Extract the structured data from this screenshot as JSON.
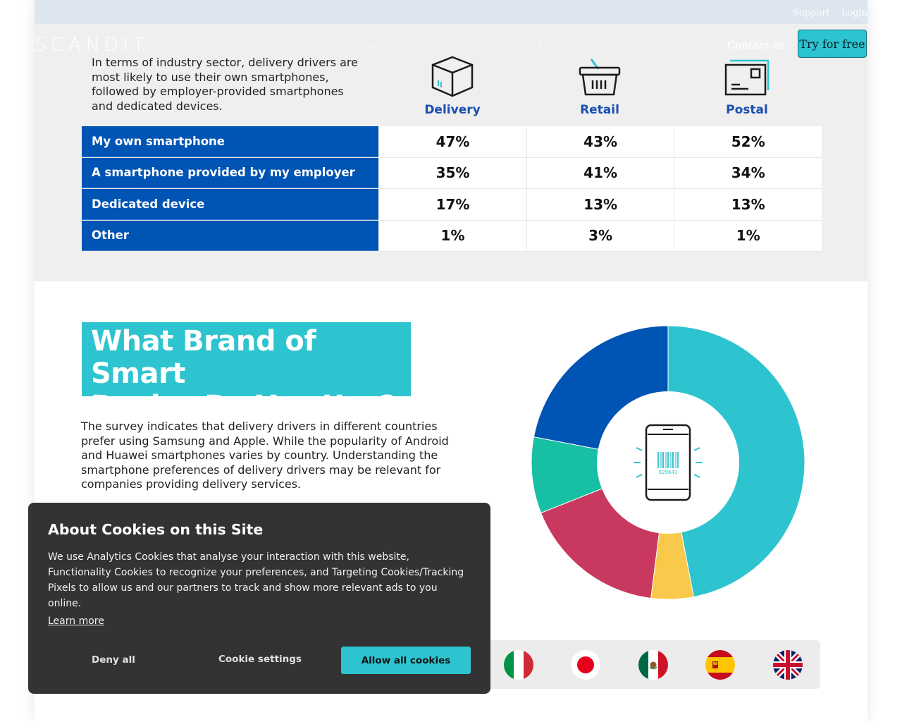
{
  "topbar": {
    "links": [
      "Support",
      "Login"
    ]
  },
  "nav": {
    "logo": "SCANDIT",
    "menu": [
      "Products",
      "Industries",
      "Developers",
      "Resources",
      "About"
    ],
    "contact_label": "Contact us",
    "try_label": "Try for free",
    "icons": [
      "search-icon",
      "globe-icon"
    ]
  },
  "device_section": {
    "intro": "In terms of industry sector, delivery drivers are most likely to use their own smartphones, followed by employer-provided smartphones and dedicated devices.",
    "sectors": [
      {
        "label": "Delivery",
        "icon": "box-icon"
      },
      {
        "label": "Retail",
        "icon": "basket-icon"
      },
      {
        "label": "Postal",
        "icon": "envelope-icon"
      }
    ],
    "rows": [
      {
        "label": "My own smartphone",
        "values": [
          "47%",
          "43%",
          "52%"
        ]
      },
      {
        "label": "A smartphone provided by my employer",
        "values": [
          "35%",
          "41%",
          "34%"
        ]
      },
      {
        "label": "Dedicated device",
        "values": [
          "17%",
          "13%",
          "13%"
        ]
      },
      {
        "label": "Other",
        "values": [
          "1%",
          "3%",
          "1%"
        ]
      }
    ]
  },
  "brand_section": {
    "headline_line1": "What Brand of Smart",
    "headline_line2": "Device Do You Use?",
    "headline_mark": "†",
    "body": "The survey indicates that delivery drivers in different countries prefer using Samsung and Apple. While the popularity of Android and Huawei smartphones varies by country. Understanding the smartphone preferences of delivery drivers may be relevant for companies providing delivery services.",
    "donut_center_code": "829643",
    "flags": [
      "italy-flag",
      "japan-flag",
      "mexico-flag",
      "spain-flag",
      "uk-flag"
    ]
  },
  "chart_data": {
    "type": "pie",
    "categories": [
      "",
      "",
      "",
      "",
      ""
    ],
    "values": [
      47,
      5,
      17,
      9,
      22
    ],
    "colors": [
      "#2ec4cf",
      "#f8c94a",
      "#c8385f",
      "#17bfa3",
      "#0054b4"
    ]
  },
  "cookie": {
    "title": "About Cookies on this Site",
    "text": "We use Analytics Cookies that analyse your interaction with this website, Functionality Cookies to recognize your preferences, and Targeting Cookies/Tracking Pixels to allow us and our partners to track and show more relevant ads to you online.",
    "learn_more": "Learn more",
    "deny": "Deny all",
    "settings": "Cookie settings",
    "allow": "Allow all cookies"
  }
}
